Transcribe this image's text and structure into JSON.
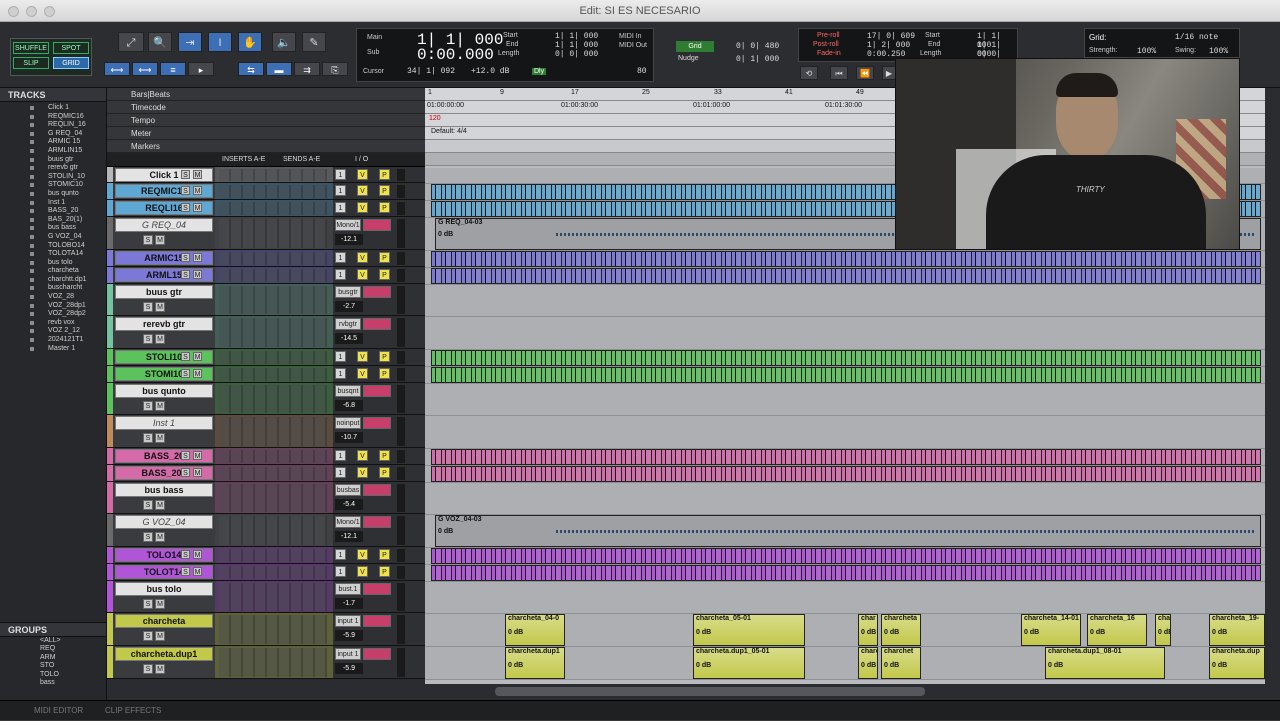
{
  "window": {
    "title": "Edit: SI ES NECESARIO"
  },
  "edit_modes": {
    "shuffle": "SHUFFLE",
    "spot": "SPOT",
    "slip": "SLIP",
    "grid": "GRID"
  },
  "counter": {
    "main_label": "Main",
    "main_value": "1| 1| 000",
    "sub_label": "Sub",
    "sub_value": "0:00.000",
    "cursor_label": "Cursor",
    "cursor_value": "34| 1| 092",
    "level": "+12.0 dB",
    "start_label": "Start",
    "end_label": "End",
    "length_label": "Length",
    "start": "1| 1| 000",
    "end": "1| 1| 000",
    "length": "0| 0| 000",
    "midi_in": "MIDI In",
    "midi_out": "MIDI Out",
    "dly": "Dly",
    "tempo": "80"
  },
  "grid_nudge": {
    "grid_label": "Grid",
    "grid_value": "0| 0| 480",
    "nudge_label": "Nudge",
    "nudge_value": "0| 1| 000"
  },
  "preroll": {
    "preroll_label": "Pre-roll",
    "postroll_label": "Post-roll",
    "fadein_label": "Fade-in",
    "preroll": "17| 0| 609",
    "postroll": "1| 2| 000",
    "fadein": "0:00.250",
    "start_label": "Start",
    "end_label": "End",
    "length_label": "Length",
    "start": "1| 1| 000",
    "end": "1| 1| 000",
    "length": "0| 0| 000"
  },
  "right_grid": {
    "label": "Grid:",
    "value": "1/16 note",
    "strength": "Strength:",
    "strength_val": "100%",
    "swing": "Swing:",
    "swing_val": "100%"
  },
  "tracks_panel": {
    "title": "TRACKS",
    "items": [
      "Click 1",
      "REQMIC16",
      "REQLIN_16",
      "G REQ_04",
      "ARMIC 15",
      "ARMLIN15",
      "buus gtr",
      "rerevb gtr",
      "STOLIN_10",
      "STOMIC10",
      "bus qunto",
      "Inst 1",
      "BASS_20",
      "BAS_20(1)",
      "bus bass",
      "G VOZ_04",
      "TOLOBO14",
      "TOLOTA14",
      "bus tolo",
      "charcheta",
      "charchtt.dp1",
      "buscharcht",
      "VOZ_28",
      "VOZ_28dp1",
      "VOZ_28dp2",
      "revb vox",
      "VOZ 2_12",
      "2024121T1",
      "Master 1"
    ]
  },
  "groups_panel": {
    "title": "GROUPS",
    "items": [
      "<ALL>",
      "REQ",
      "ARM",
      "STO",
      "TOLO",
      "bass"
    ]
  },
  "rulers": {
    "bars": "Bars|Beats",
    "timecode": "Timecode",
    "tempo": "Tempo",
    "meter": "Meter",
    "markers": "Markers",
    "tempo_value": "120",
    "meter_value": "Default: 4/4"
  },
  "column_headers": {
    "inserts": "INSERTS A-E",
    "sends": "SENDS A-E",
    "io": "I / O"
  },
  "bar_ticks": [
    "1",
    "9",
    "17",
    "25",
    "33",
    "41",
    "49"
  ],
  "timecode_ticks": [
    "01:00:00:00",
    "01:00:30:00",
    "01:01:00:00",
    "01:01:30:00"
  ],
  "tracks": [
    {
      "name": "Click 1",
      "color": "#b7b7b7",
      "type": "aux",
      "vol": "",
      "io": "",
      "h": 16
    },
    {
      "name": "REQMIC16",
      "color": "#5fa8d3",
      "type": "audio",
      "vol": "",
      "io": "",
      "h": 17
    },
    {
      "name": "REQLI16",
      "color": "#5fa8d3",
      "type": "audio",
      "vol": "",
      "io": "",
      "h": 17
    },
    {
      "name": "G REQ_04",
      "color": "#6a6a6a",
      "type": "inst",
      "vol": "-12.1",
      "io": "Mono/1",
      "h": 33
    },
    {
      "name": "ARMIC15",
      "color": "#7b78d8",
      "type": "audio",
      "vol": "",
      "io": "",
      "h": 17
    },
    {
      "name": "ARML15",
      "color": "#7b78d8",
      "type": "audio",
      "vol": "",
      "io": "",
      "h": 17
    },
    {
      "name": "buus gtr",
      "color": "#74c2a0",
      "type": "aux",
      "vol": "-2.7",
      "io": "busgtr",
      "h": 32
    },
    {
      "name": "rerevb gtr",
      "color": "#74c2a0",
      "type": "aux",
      "vol": "-14.5",
      "io": "rvbgtr",
      "h": 33
    },
    {
      "name": "STOLI10",
      "color": "#5cc25c",
      "type": "audio",
      "vol": "",
      "io": "",
      "h": 17
    },
    {
      "name": "STOMI10",
      "color": "#5cc25c",
      "type": "audio",
      "vol": "",
      "io": "",
      "h": 17
    },
    {
      "name": "bus qunto",
      "color": "#5cc25c",
      "type": "aux",
      "vol": "-6.8",
      "io": "busqnt",
      "h": 32
    },
    {
      "name": "Inst 1",
      "color": "#c08a5a",
      "type": "inst",
      "vol": "-10.7",
      "io": "noinput",
      "h": 33
    },
    {
      "name": "BASS_20",
      "color": "#d46aa8",
      "type": "audio",
      "vol": "",
      "io": "",
      "h": 17
    },
    {
      "name": "BASS_201",
      "color": "#d46aa8",
      "type": "audio",
      "vol": "",
      "io": "",
      "h": 17
    },
    {
      "name": "bus bass",
      "color": "#d46aa8",
      "type": "aux",
      "vol": "-5.4",
      "io": "busbas",
      "h": 32
    },
    {
      "name": "G VOZ_04",
      "color": "#6a6a6a",
      "type": "inst",
      "vol": "-12.1",
      "io": "Mono/1",
      "h": 33
    },
    {
      "name": "TOLO14",
      "color": "#b054d8",
      "type": "audio",
      "vol": "",
      "io": "",
      "h": 17
    },
    {
      "name": "TOLOT14",
      "color": "#b054d8",
      "type": "audio",
      "vol": "",
      "io": "",
      "h": 17
    },
    {
      "name": "bus tolo",
      "color": "#b054d8",
      "type": "aux",
      "vol": "-1.7",
      "io": "bust.1",
      "h": 32
    },
    {
      "name": "charcheta",
      "color": "#c2c84a",
      "type": "audio",
      "vol": "-5.9",
      "io": "input 1",
      "h": 33
    },
    {
      "name": "charcheta.dup1",
      "color": "#c2c84a",
      "type": "audio",
      "vol": "-5.9",
      "io": "input 1",
      "h": 33
    }
  ],
  "clips": {
    "greq": "G REQ_04-03",
    "gvoz": "G VOZ_04-03",
    "db": "0 dB",
    "charcheta": [
      "charcheta_04-0",
      "charcheta_05-01",
      "char",
      "charcheta",
      "charcheta_14-01",
      "charcheta_16",
      "cha",
      "charcheta_19-"
    ],
    "charcheta_dup": [
      "charcheta.dup1",
      "charcheta.dup1_05-01",
      "charc",
      "charchet",
      "charcheta.dup1_08-01",
      "charcheta.dup"
    ]
  },
  "bottom": {
    "midi_editor": "MIDI EDITOR",
    "clip_effects": "CLIP EFFECTS"
  },
  "webcam": {
    "shirt_text": "THIRTY"
  }
}
